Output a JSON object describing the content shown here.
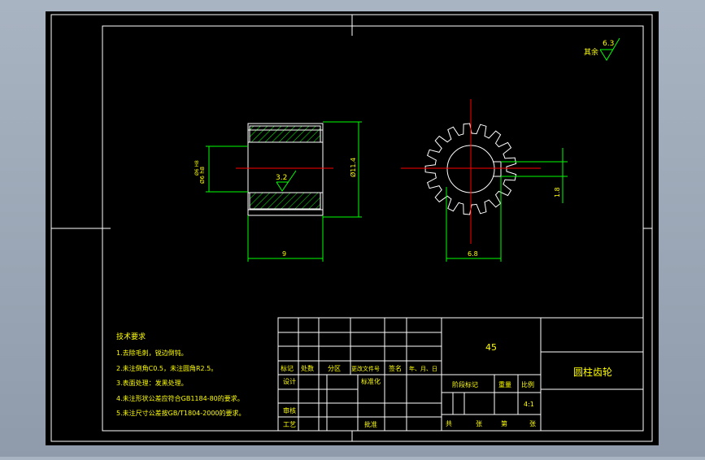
{
  "colors": {
    "background_outer": "#9aa6b5",
    "canvas": "#000000",
    "frame": "#ffffff",
    "geometry": "#ffffff",
    "dimension": "#00ff00",
    "centerline": "#ff0000",
    "hatch": "#00ff00",
    "text": "#ffff00"
  },
  "roughness": {
    "general_value": "6.3",
    "general_label": "其余",
    "section_value": "3.2"
  },
  "dimensions": {
    "side_height": "Ø11.4",
    "bore": "Ø6 h8",
    "hub": "Ø6 H8",
    "width": "9",
    "keyway_width": "6.8",
    "keyway_depth": "1.8"
  },
  "tech_requirements": {
    "title": "技术要求",
    "items": [
      "1.去除毛刺，锐边倒钝。",
      "2.未注倒角C0.5，未注圆角R2.5。",
      "3.表面处理：发黑处理。",
      "4.未注形状公差应符合GB1184-80的要求。",
      "5.未注尺寸公差按GB/T1804-2000的要求。"
    ]
  },
  "title_block": {
    "material": "45",
    "part_name": "圆柱齿轮",
    "headers": [
      "标记",
      "处数",
      "分区",
      "更改文件号",
      "签名",
      "年、月、日"
    ],
    "design": "设计",
    "standardization": "标准化",
    "review": "审核",
    "process": "工艺",
    "approve": "批准",
    "stage_mark": "阶段标记",
    "weight": "重量",
    "scale_label": "比例",
    "scale_value": "4:1",
    "total_label": "共",
    "sheet_unit": "张",
    "sheet_label": "第",
    "sheet_unit2": "张"
  }
}
